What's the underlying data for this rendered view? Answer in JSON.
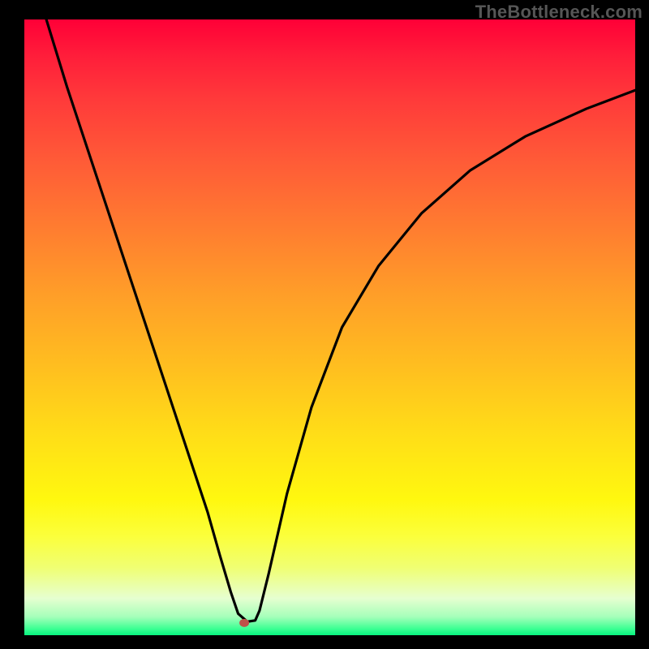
{
  "watermark": "TheBottleneck.com",
  "chart_data": {
    "type": "line",
    "title": "",
    "xlabel": "",
    "ylabel": "",
    "xlim": [
      0,
      100
    ],
    "ylim": [
      0,
      100
    ],
    "grid": false,
    "legend": false,
    "background": {
      "style": "vertical-gradient",
      "stops": [
        {
          "pos": 0,
          "color": "#ff0037"
        },
        {
          "pos": 13,
          "color": "#ff3a3a"
        },
        {
          "pos": 34,
          "color": "#ff7d30"
        },
        {
          "pos": 57,
          "color": "#ffc01f"
        },
        {
          "pos": 78,
          "color": "#fff80f"
        },
        {
          "pos": 94,
          "color": "#e6ffd0"
        },
        {
          "pos": 100,
          "color": "#07f37f"
        }
      ]
    },
    "series": [
      {
        "name": "bottleneck-curve",
        "x": [
          3.6,
          7,
          12,
          17,
          22,
          27,
          30,
          32,
          33.8,
          35,
          36.5,
          37.8,
          38.5,
          40,
          43,
          47,
          52,
          58,
          65,
          73,
          82,
          92,
          100
        ],
        "y": [
          100,
          89,
          74,
          59,
          44,
          29,
          20,
          13,
          7,
          3.5,
          2.2,
          2.4,
          4,
          10,
          23,
          37,
          50,
          60,
          68.5,
          75.5,
          81,
          85.5,
          88.5
        ]
      }
    ],
    "marker": {
      "x": 36,
      "y": 2,
      "color": "#bf5149",
      "rx": 6,
      "ry": 5
    }
  }
}
